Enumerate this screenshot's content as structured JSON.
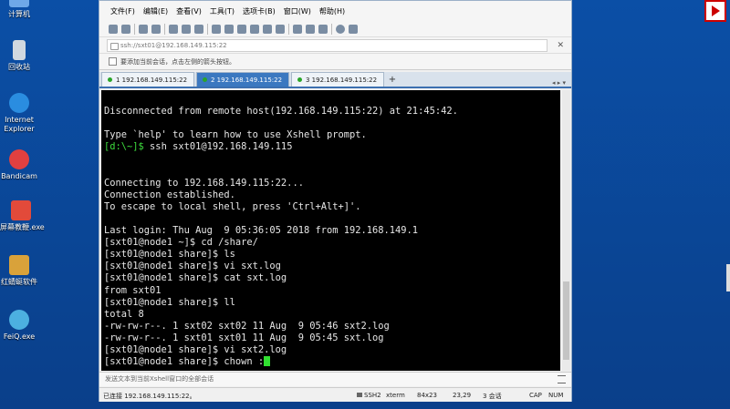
{
  "desktop": {
    "icons": [
      {
        "label": "计算机",
        "icon": "computer-icon",
        "color": "#6ea8e8"
      },
      {
        "label": "回收站",
        "icon": "recycle-bin-icon",
        "color": "#d0d8e0"
      },
      {
        "label": "Internet Explorer",
        "icon": "internet-explorer-icon",
        "color": "#2a8de0"
      },
      {
        "label": "Bandicam",
        "icon": "bandicam-icon",
        "color": "#e04040"
      },
      {
        "label": "屏幕教鞭.exe",
        "icon": "screen-pointer-icon",
        "color": "#e24a3a"
      },
      {
        "label": "红蜻蜓软件",
        "icon": "red-dragonfly-icon",
        "color": "#d9a23a"
      },
      {
        "label": "FeiQ.exe",
        "icon": "feiq-icon",
        "color": "#4cb0e0"
      }
    ]
  },
  "menubar": [
    "文件(F)",
    "编辑(E)",
    "查看(V)",
    "工具(T)",
    "选项卡(B)",
    "窗口(W)",
    "帮助(H)"
  ],
  "address": {
    "value": "ssh://sxt01@192.168.149.115:22"
  },
  "hint": "要添加当前会话，点击左侧的箭头按钮。",
  "tabs": [
    {
      "label": "1 192.168.149.115:22",
      "active": false
    },
    {
      "label": "2 192.168.149.115:22",
      "active": true
    },
    {
      "label": "3 192.168.149.115:22",
      "active": false
    }
  ],
  "terminal": {
    "lines": [
      "",
      "Disconnected from remote host(192.168.149.115:22) at 21:45:42.",
      "",
      "Type `help' to learn how to use Xshell prompt.",
      "[d:\\~]$ ssh sxt01@192.168.149.115",
      "",
      "",
      "Connecting to 192.168.149.115:22...",
      "Connection established.",
      "To escape to local shell, press 'Ctrl+Alt+]'.",
      "",
      "Last login: Thu Aug  9 05:36:05 2018 from 192.168.149.1",
      "[sxt01@node1 ~]$ cd /share/",
      "[sxt01@node1 share]$ ls",
      "[sxt01@node1 share]$ vi sxt.log",
      "[sxt01@node1 share]$ cat sxt.log",
      "from sxt01",
      "[sxt01@node1 share]$ ll",
      "total 8",
      "-rw-rw-r--. 1 sxt02 sxt02 11 Aug  9 05:46 sxt2.log",
      "-rw-rw-r--. 1 sxt01 sxt01 11 Aug  9 05:45 sxt.log",
      "[sxt01@node1 share]$ vi sxt2.log",
      "[sxt01@node1 share]$ chown :"
    ]
  },
  "sendbar": "发送文本到当前Xshell窗口的全部会话",
  "status": {
    "connection": "已连接 192.168.149.115:22。",
    "protocol": "SSH2",
    "term": "xterm",
    "size": "84x23",
    "position": "23,29",
    "sessions": "3 会话",
    "caps": "CAP",
    "num": "NUM"
  }
}
